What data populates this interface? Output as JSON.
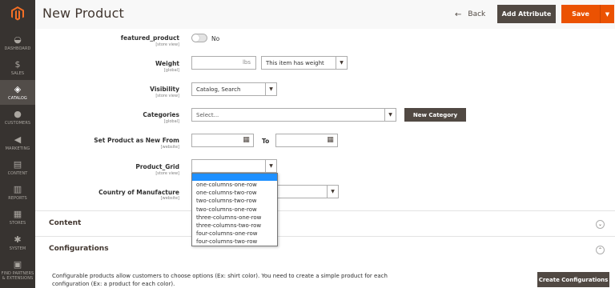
{
  "header": {
    "title": "New Product",
    "back_label": "Back",
    "back_icon": "arrow-left-icon",
    "add_attribute_label": "Add Attribute",
    "save_label": "Save"
  },
  "sidebar": {
    "items": [
      {
        "label": "DASHBOARD",
        "icon": "dashboard-icon",
        "active": false
      },
      {
        "label": "SALES",
        "icon": "dollar-icon",
        "active": false
      },
      {
        "label": "CATALOG",
        "icon": "cube-icon",
        "active": true
      },
      {
        "label": "CUSTOMERS",
        "icon": "user-icon",
        "active": false
      },
      {
        "label": "MARKETING",
        "icon": "megaphone-icon",
        "active": false
      },
      {
        "label": "CONTENT",
        "icon": "layout-icon",
        "active": false
      },
      {
        "label": "REPORTS",
        "icon": "bar-chart-icon",
        "active": false
      },
      {
        "label": "STORES",
        "icon": "store-icon",
        "active": false
      },
      {
        "label": "SYSTEM",
        "icon": "gear-icon",
        "active": false
      },
      {
        "label": "FIND PARTNERS & EXTENSIONS",
        "icon": "puzzle-icon",
        "active": false
      }
    ]
  },
  "form": {
    "featured_product": {
      "label": "featured_product",
      "scope": "[store view]",
      "value": "No"
    },
    "weight": {
      "label": "Weight",
      "scope": "[global]",
      "unit": "lbs",
      "value": "",
      "has_weight": "This item has weight"
    },
    "visibility": {
      "label": "Visibility",
      "scope": "[store view]",
      "value": "Catalog, Search"
    },
    "categories": {
      "label": "Categories",
      "scope": "[global]",
      "placeholder": "Select...",
      "new_category_label": "New Category"
    },
    "new_from": {
      "label": "Set Product as New From",
      "scope": "[website]",
      "to_label": "To"
    },
    "product_grid": {
      "label": "Product_Grid",
      "scope": "[store view]",
      "value": "",
      "options": [
        "one-columns-one-row",
        "one-columns-two-row",
        "two-columns-two-row",
        "two-columns-one-row",
        "three-columns-one-row",
        "three-columns-two-row",
        "four-columns-one-row",
        "four-columns-two-row"
      ]
    },
    "country": {
      "label": "Country of Manufacture",
      "scope": "[website]"
    }
  },
  "sections": {
    "content": {
      "title": "Content"
    },
    "configurations": {
      "title": "Configurations",
      "description": "Configurable products allow customers to choose options (Ex: shirt color). You need to create a simple product for each configuration (Ex: a product for each color).",
      "create_button": "Create Configurations"
    }
  },
  "colors": {
    "sidebar_bg": "#373330",
    "accent": "#eb5202",
    "dark_button": "#514943",
    "dropdown_highlight": "#1e90ff"
  }
}
